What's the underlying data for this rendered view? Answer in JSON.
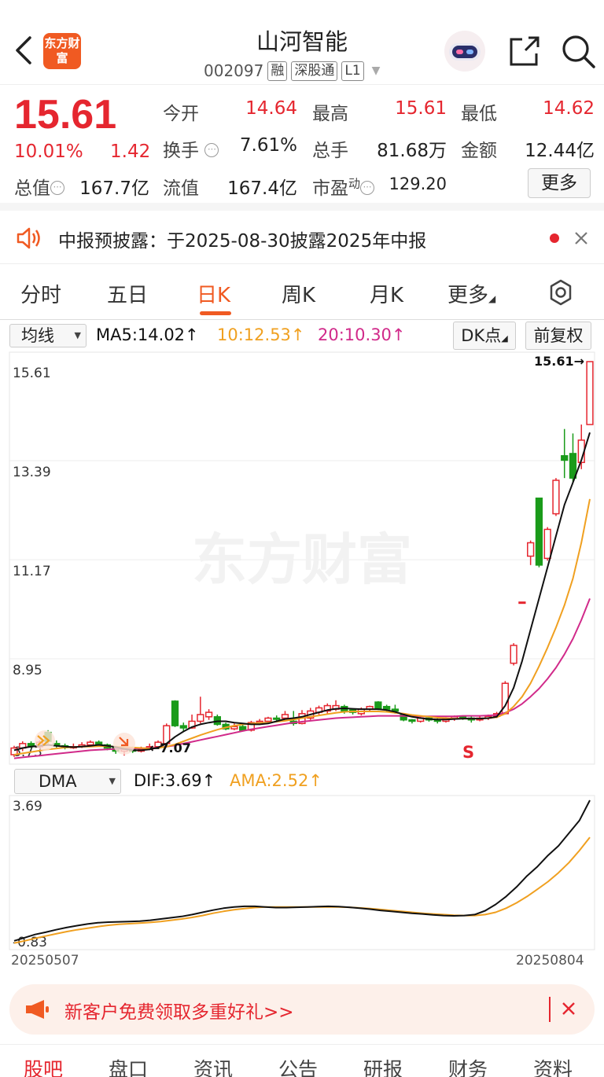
{
  "header": {
    "logo_text": "东方财富",
    "stock_name": "山河智能",
    "code": "002097",
    "tags": [
      "融",
      "深股通",
      "L1"
    ]
  },
  "quote": {
    "price": "15.61",
    "change_pct": "10.01%",
    "change": "1.42",
    "fields": [
      {
        "label": "今开",
        "value": "14.64"
      },
      {
        "label": "最高",
        "value": "15.61"
      },
      {
        "label": "最低",
        "value": "14.62"
      },
      {
        "label": "换手",
        "value": "7.61%"
      },
      {
        "label": "总手",
        "value": "81.68万"
      },
      {
        "label": "金额",
        "value": "12.44亿"
      },
      {
        "label": "总值",
        "value": "167.7亿"
      },
      {
        "label": "流值",
        "value": "167.4亿"
      },
      {
        "label": "市盈",
        "label_sup": "动",
        "value": "129.20"
      }
    ],
    "more_label": "更多"
  },
  "notice": {
    "text": "中报预披露：于2025-08-30披露2025年中报"
  },
  "tabs": [
    {
      "label": "分时"
    },
    {
      "label": "五日"
    },
    {
      "label": "日K"
    },
    {
      "label": "周K"
    },
    {
      "label": "月K"
    },
    {
      "label": "更多"
    }
  ],
  "ma_row": {
    "selector": "均线",
    "ma5": "MA5:14.02↑",
    "ma10": "10:12.53↑",
    "ma20": "20:10.30↑",
    "dk": "DK点",
    "adjust": "前复权"
  },
  "kline": {
    "y_labels": [
      "15.61",
      "13.39",
      "11.17",
      "8.95",
      "6.73"
    ],
    "watermark": "东方财富",
    "high_marker": "15.61→",
    "low_marker": "←7.07",
    "signal": "S",
    "colors": {
      "up": "#e5262f",
      "down": "#1a9b1a",
      "ma5": "#111111",
      "ma10": "#f0a020",
      "ma20": "#d12a8a"
    }
  },
  "dma_row": {
    "selector": "DMA",
    "dif": "DIF:3.69↑",
    "ama": "AMA:2.52↑",
    "y_labels": [
      "3.69",
      "-0.83"
    ]
  },
  "dates": {
    "start": "20250507",
    "end": "20250804"
  },
  "promo": {
    "text": "新客户免费领取多重好礼>>"
  },
  "bottom_nav": [
    {
      "label": "股吧"
    },
    {
      "label": "盘口"
    },
    {
      "label": "资讯"
    },
    {
      "label": "公告"
    },
    {
      "label": "研报"
    },
    {
      "label": "财务"
    },
    {
      "label": "资料"
    }
  ],
  "chart_data": {
    "type": "candlestick",
    "ylim": [
      6.73,
      15.61
    ],
    "candles": [
      {
        "o": 6.8,
        "c": 6.95,
        "h": 7.0,
        "l": 6.75
      },
      {
        "o": 6.95,
        "c": 7.05,
        "h": 7.1,
        "l": 6.88
      },
      {
        "o": 7.05,
        "c": 6.98,
        "h": 7.1,
        "l": 6.95
      },
      {
        "o": 6.98,
        "c": 7.08,
        "h": 7.12,
        "l": 6.95
      },
      {
        "o": 7.3,
        "c": 7.1,
        "h": 7.35,
        "l": 7.05
      },
      {
        "o": 7.05,
        "c": 7.0,
        "h": 7.12,
        "l": 6.96
      },
      {
        "o": 7.0,
        "c": 6.96,
        "h": 7.05,
        "l": 6.92
      },
      {
        "o": 6.96,
        "c": 6.98,
        "h": 7.05,
        "l": 6.93
      },
      {
        "o": 6.98,
        "c": 7.02,
        "h": 7.08,
        "l": 6.95
      },
      {
        "o": 7.02,
        "c": 7.08,
        "h": 7.12,
        "l": 6.98
      },
      {
        "o": 7.08,
        "c": 7.02,
        "h": 7.12,
        "l": 6.98
      },
      {
        "o": 7.02,
        "c": 6.95,
        "h": 7.05,
        "l": 6.9
      },
      {
        "o": 6.95,
        "c": 6.88,
        "h": 6.98,
        "l": 6.82
      },
      {
        "o": 6.88,
        "c": 6.92,
        "h": 6.96,
        "l": 6.78
      },
      {
        "o": 6.92,
        "c": 6.88,
        "h": 6.98,
        "l": 6.84
      },
      {
        "o": 6.88,
        "c": 6.92,
        "h": 6.98,
        "l": 6.85
      },
      {
        "o": 6.92,
        "c": 6.98,
        "h": 7.05,
        "l": 6.9
      },
      {
        "o": 6.98,
        "c": 7.08,
        "h": 7.12,
        "l": 6.96
      },
      {
        "o": 7.05,
        "c": 7.45,
        "h": 7.5,
        "l": 7.02
      },
      {
        "o": 8.0,
        "c": 7.45,
        "h": 8.02,
        "l": 7.42
      },
      {
        "o": 7.45,
        "c": 7.4,
        "h": 7.52,
        "l": 7.32
      },
      {
        "o": 7.4,
        "c": 7.55,
        "h": 7.7,
        "l": 7.38
      },
      {
        "o": 7.55,
        "c": 7.7,
        "h": 8.1,
        "l": 7.5
      },
      {
        "o": 7.65,
        "c": 7.75,
        "h": 7.82,
        "l": 7.58
      },
      {
        "o": 7.65,
        "c": 7.48,
        "h": 7.7,
        "l": 7.45
      },
      {
        "o": 7.48,
        "c": 7.38,
        "h": 7.52,
        "l": 7.35
      },
      {
        "o": 7.38,
        "c": 7.43,
        "h": 7.5,
        "l": 7.35
      },
      {
        "o": 7.43,
        "c": 7.35,
        "h": 7.48,
        "l": 7.32
      },
      {
        "o": 7.35,
        "c": 7.52,
        "h": 7.56,
        "l": 7.32
      },
      {
        "o": 7.52,
        "c": 7.55,
        "h": 7.6,
        "l": 7.48
      },
      {
        "o": 7.55,
        "c": 7.62,
        "h": 7.65,
        "l": 7.5
      },
      {
        "o": 7.62,
        "c": 7.6,
        "h": 7.68,
        "l": 7.55
      },
      {
        "o": 7.62,
        "c": 7.7,
        "h": 7.78,
        "l": 7.58
      },
      {
        "o": 7.55,
        "c": 7.5,
        "h": 7.78,
        "l": 7.45
      },
      {
        "o": 7.5,
        "c": 7.72,
        "h": 7.8,
        "l": 7.48
      },
      {
        "o": 7.62,
        "c": 7.78,
        "h": 7.85,
        "l": 7.58
      },
      {
        "o": 7.75,
        "c": 7.85,
        "h": 7.9,
        "l": 7.7
      },
      {
        "o": 7.78,
        "c": 7.9,
        "h": 7.95,
        "l": 7.72
      },
      {
        "o": 7.82,
        "c": 7.9,
        "h": 8.02,
        "l": 7.78
      },
      {
        "o": 7.88,
        "c": 7.78,
        "h": 7.92,
        "l": 7.72
      },
      {
        "o": 7.8,
        "c": 7.75,
        "h": 7.82,
        "l": 7.7
      },
      {
        "o": 7.72,
        "c": 7.82,
        "h": 7.86,
        "l": 7.68
      },
      {
        "o": 7.82,
        "c": 7.88,
        "h": 7.9,
        "l": 7.78
      },
      {
        "o": 7.98,
        "c": 7.82,
        "h": 8.0,
        "l": 7.8
      },
      {
        "o": 7.88,
        "c": 7.82,
        "h": 7.92,
        "l": 7.78
      },
      {
        "o": 7.82,
        "c": 7.78,
        "h": 7.92,
        "l": 7.72
      },
      {
        "o": 7.7,
        "c": 7.58,
        "h": 7.72,
        "l": 7.55
      },
      {
        "o": 7.58,
        "c": 7.55,
        "h": 7.6,
        "l": 7.5
      },
      {
        "o": 7.55,
        "c": 7.62,
        "h": 7.66,
        "l": 7.52
      },
      {
        "o": 7.62,
        "c": 7.58,
        "h": 7.66,
        "l": 7.54
      },
      {
        "o": 7.58,
        "c": 7.55,
        "h": 7.62,
        "l": 7.5
      },
      {
        "o": 7.55,
        "c": 7.6,
        "h": 7.64,
        "l": 7.52
      },
      {
        "o": 7.6,
        "c": 7.65,
        "h": 7.68,
        "l": 7.56
      },
      {
        "o": 7.65,
        "c": 7.62,
        "h": 7.68,
        "l": 7.58
      },
      {
        "o": 7.62,
        "c": 7.58,
        "h": 7.66,
        "l": 7.52
      },
      {
        "o": 7.58,
        "c": 7.62,
        "h": 7.66,
        "l": 7.55
      },
      {
        "o": 7.62,
        "c": 7.66,
        "h": 7.7,
        "l": 7.58
      },
      {
        "o": 7.66,
        "c": 7.72,
        "h": 7.76,
        "l": 7.62
      },
      {
        "o": 7.72,
        "c": 8.4,
        "h": 8.45,
        "l": 7.7
      },
      {
        "o": 8.85,
        "c": 9.25,
        "h": 9.3,
        "l": 8.8
      },
      {
        "o": 10.22,
        "c": 10.22,
        "h": 10.22,
        "l": 10.22
      },
      {
        "o": 11.25,
        "c": 11.55,
        "h": 11.6,
        "l": 11.05
      },
      {
        "o": 12.55,
        "c": 11.05,
        "h": 12.55,
        "l": 11.0
      },
      {
        "o": 11.2,
        "c": 11.85,
        "h": 11.9,
        "l": 11.15
      },
      {
        "o": 12.2,
        "c": 12.95,
        "h": 13.0,
        "l": 12.15
      },
      {
        "o": 13.5,
        "c": 13.4,
        "h": 14.1,
        "l": 13.0
      },
      {
        "o": 13.55,
        "c": 13.0,
        "h": 14.0,
        "l": 12.9
      },
      {
        "o": 13.35,
        "c": 13.85,
        "h": 14.2,
        "l": 13.2
      },
      {
        "o": 14.2,
        "c": 15.61,
        "h": 15.61,
        "l": 14.2
      }
    ],
    "ma5": [
      6.9,
      6.95,
      6.98,
      7.0,
      7.02,
      7.0,
      6.98,
      6.97,
      6.98,
      7.0,
      7.02,
      7.0,
      6.97,
      6.93,
      6.9,
      6.9,
      6.92,
      6.96,
      7.05,
      7.2,
      7.32,
      7.42,
      7.48,
      7.52,
      7.55,
      7.55,
      7.52,
      7.5,
      7.48,
      7.48,
      7.5,
      7.55,
      7.6,
      7.62,
      7.65,
      7.7,
      7.75,
      7.8,
      7.83,
      7.84,
      7.83,
      7.82,
      7.82,
      7.82,
      7.8,
      7.76,
      7.7,
      7.65,
      7.62,
      7.6,
      7.59,
      7.59,
      7.6,
      7.61,
      7.61,
      7.61,
      7.62,
      7.65,
      7.9,
      8.3,
      8.9,
      9.6,
      10.3,
      11.0,
      11.7,
      12.4,
      12.9,
      13.4,
      14.02
    ],
    "ma10": [
      6.8,
      6.83,
      6.86,
      6.89,
      6.92,
      6.94,
      6.96,
      6.97,
      6.98,
      6.98,
      6.99,
      6.99,
      6.98,
      6.97,
      6.96,
      6.95,
      6.94,
      6.95,
      6.98,
      7.03,
      7.1,
      7.17,
      7.24,
      7.3,
      7.36,
      7.41,
      7.45,
      7.48,
      7.5,
      7.51,
      7.52,
      7.54,
      7.56,
      7.59,
      7.62,
      7.65,
      7.68,
      7.71,
      7.74,
      7.76,
      7.77,
      7.77,
      7.77,
      7.77,
      7.76,
      7.74,
      7.72,
      7.69,
      7.67,
      7.65,
      7.63,
      7.62,
      7.61,
      7.61,
      7.61,
      7.61,
      7.62,
      7.64,
      7.72,
      7.88,
      8.1,
      8.4,
      8.78,
      9.2,
      9.65,
      10.15,
      10.75,
      11.55,
      12.53
    ],
    "ma20": [
      6.72,
      6.74,
      6.76,
      6.78,
      6.8,
      6.82,
      6.84,
      6.86,
      6.88,
      6.9,
      6.91,
      6.92,
      6.93,
      6.93,
      6.94,
      6.94,
      6.95,
      6.96,
      6.98,
      7.01,
      7.05,
      7.09,
      7.13,
      7.17,
      7.21,
      7.25,
      7.29,
      7.33,
      7.37,
      7.4,
      7.43,
      7.46,
      7.49,
      7.52,
      7.54,
      7.56,
      7.58,
      7.6,
      7.62,
      7.63,
      7.64,
      7.65,
      7.66,
      7.67,
      7.67,
      7.67,
      7.67,
      7.66,
      7.66,
      7.66,
      7.66,
      7.66,
      7.66,
      7.67,
      7.67,
      7.67,
      7.68,
      7.69,
      7.74,
      7.82,
      7.94,
      8.1,
      8.28,
      8.5,
      8.75,
      9.05,
      9.4,
      9.82,
      10.3
    ],
    "dma": {
      "ylim": [
        -0.83,
        3.69
      ],
      "dif": [
        -0.75,
        -0.65,
        -0.55,
        -0.48,
        -0.4,
        -0.33,
        -0.27,
        -0.22,
        -0.18,
        -0.16,
        -0.15,
        -0.14,
        -0.13,
        -0.1,
        -0.06,
        -0.02,
        0.02,
        0.08,
        0.15,
        0.22,
        0.28,
        0.32,
        0.34,
        0.34,
        0.32,
        0.3,
        0.3,
        0.31,
        0.32,
        0.33,
        0.34,
        0.33,
        0.31,
        0.28,
        0.25,
        0.21,
        0.18,
        0.15,
        0.12,
        0.1,
        0.07,
        0.05,
        0.04,
        0.05,
        0.08,
        0.2,
        0.4,
        0.65,
        0.95,
        1.3,
        1.6,
        1.95,
        2.25,
        2.65,
        3.05,
        3.69
      ],
      "ama": [
        -0.82,
        -0.75,
        -0.67,
        -0.6,
        -0.53,
        -0.46,
        -0.4,
        -0.35,
        -0.3,
        -0.26,
        -0.23,
        -0.21,
        -0.19,
        -0.17,
        -0.14,
        -0.1,
        -0.06,
        -0.01,
        0.05,
        0.12,
        0.18,
        0.23,
        0.27,
        0.3,
        0.32,
        0.32,
        0.32,
        0.32,
        0.32,
        0.32,
        0.32,
        0.32,
        0.31,
        0.29,
        0.27,
        0.24,
        0.21,
        0.18,
        0.15,
        0.12,
        0.1,
        0.08,
        0.06,
        0.05,
        0.05,
        0.08,
        0.15,
        0.28,
        0.45,
        0.65,
        0.88,
        1.12,
        1.4,
        1.72,
        2.1,
        2.52
      ]
    }
  }
}
